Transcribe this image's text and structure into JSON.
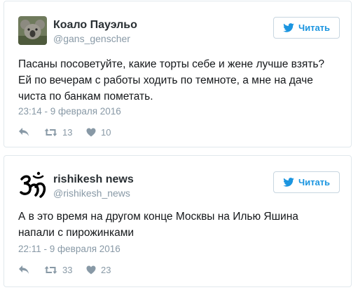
{
  "tweets": [
    {
      "name": "Коало Пауэльо",
      "handle": "@gans_genscher",
      "follow_label": "Читать",
      "text": "Пасаны посоветуйте, какие торты себе и жене лучше взять?\nЕй по вечерам с работы ходить по темноте, а мне на даче\nчиста по банкам пометать.",
      "timestamp": "23:14 - 9 февраля 2016",
      "retweets": "13",
      "likes": "10",
      "avatar_icon": "koala-photo"
    },
    {
      "name": "rishikesh news",
      "handle": "@rishikesh_news",
      "follow_label": "Читать",
      "text": "А в это время на другом конце Москвы на Илью Яшина\nнапали с пирожинками",
      "timestamp": "22:11 - 9 февраля 2016",
      "retweets": "33",
      "likes": "23",
      "avatar_icon": "om-symbol"
    }
  ],
  "colors": {
    "accent": "#1b95e0",
    "muted": "#8899a6",
    "border": "#e1e8ed"
  }
}
